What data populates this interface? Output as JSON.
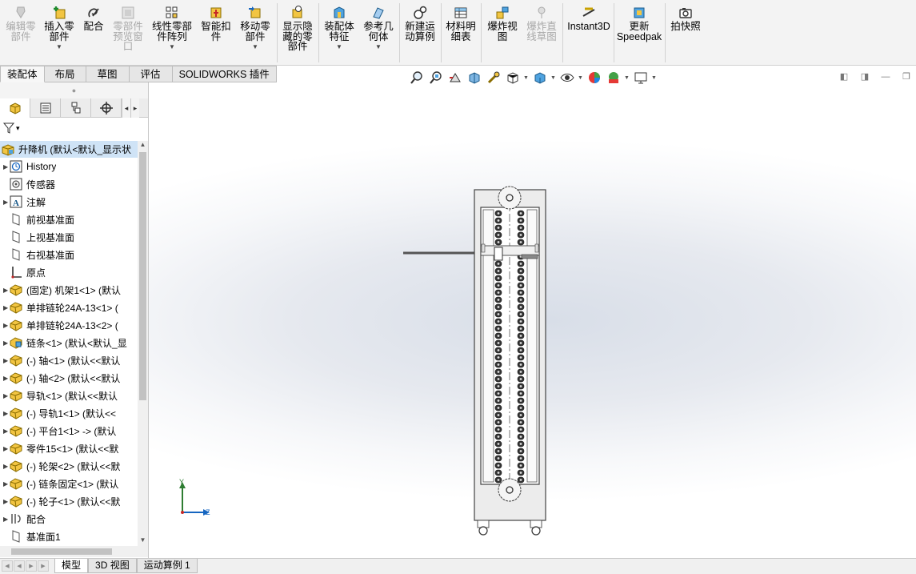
{
  "ribbon": {
    "buttons": [
      {
        "label": "编辑零\n部件",
        "icon": "edit-component-icon",
        "disabled": true
      },
      {
        "label": "插入零\n部件",
        "icon": "insert-component-icon",
        "disabled": false
      },
      {
        "label": "配合",
        "icon": "mate-icon",
        "disabled": false
      },
      {
        "label": "零部件\n预览窗\n口",
        "icon": "preview-window-icon",
        "disabled": true
      },
      {
        "label": "线性零部\n件阵列",
        "icon": "linear-pattern-icon",
        "disabled": false
      },
      {
        "label": "智能扣\n件",
        "icon": "smart-fastener-icon",
        "disabled": false
      },
      {
        "label": "移动零\n部件",
        "icon": "move-component-icon",
        "disabled": false
      },
      {
        "label": "显示隐\n藏的零\n部件",
        "icon": "show-hidden-icon",
        "disabled": false
      },
      {
        "label": "装配体\n特征",
        "icon": "assembly-feature-icon",
        "disabled": false
      },
      {
        "label": "参考几\n何体",
        "icon": "reference-geometry-icon",
        "disabled": false
      },
      {
        "label": "新建运\n动算例",
        "icon": "motion-study-icon",
        "disabled": false
      },
      {
        "label": "材料明\n细表",
        "icon": "bill-of-materials-icon",
        "disabled": false
      },
      {
        "label": "爆炸视\n图",
        "icon": "exploded-view-icon",
        "disabled": false
      },
      {
        "label": "爆炸直\n线草图",
        "icon": "explode-line-sketch-icon",
        "disabled": true
      },
      {
        "label": "Instant3D",
        "icon": "instant3d-icon",
        "disabled": false
      },
      {
        "label": "更新\nSpeedpak",
        "icon": "speedpak-icon",
        "disabled": false
      },
      {
        "label": "拍快照",
        "icon": "snapshot-icon",
        "disabled": false
      }
    ]
  },
  "command_tabs": [
    "装配体",
    "布局",
    "草图",
    "评估",
    "SOLIDWORKS 插件"
  ],
  "feature_tree": {
    "root": "升降机 (默认<默认_显示状",
    "items": [
      {
        "label": "History",
        "icon": "history-icon",
        "expand": true
      },
      {
        "label": "传感器",
        "icon": "sensor-icon",
        "expand": false
      },
      {
        "label": "注解",
        "icon": "annotation-icon",
        "expand": true
      },
      {
        "label": "前视基准面",
        "icon": "plane-icon",
        "expand": false
      },
      {
        "label": "上视基准面",
        "icon": "plane-icon",
        "expand": false
      },
      {
        "label": "右视基准面",
        "icon": "plane-icon",
        "expand": false
      },
      {
        "label": "原点",
        "icon": "origin-icon",
        "expand": false
      },
      {
        "label": "(固定) 机架1<1> (默认",
        "icon": "part-icon",
        "expand": true
      },
      {
        "label": "单排链轮24A-13<1> (",
        "icon": "part-icon",
        "expand": true
      },
      {
        "label": "单排链轮24A-13<2> (",
        "icon": "part-icon",
        "expand": true
      },
      {
        "label": "链条<1> (默认<默认_显",
        "icon": "subassembly-icon",
        "expand": true
      },
      {
        "label": "(-) 轴<1> (默认<<默认",
        "icon": "part-icon",
        "expand": true
      },
      {
        "label": "(-) 轴<2> (默认<<默认",
        "icon": "part-icon",
        "expand": true
      },
      {
        "label": "导轨<1> (默认<<默认",
        "icon": "part-icon",
        "expand": true
      },
      {
        "label": "(-) 导轨1<1> (默认<<",
        "icon": "part-icon",
        "expand": true
      },
      {
        "label": "(-) 平台1<1> -> (默认",
        "icon": "part-icon",
        "expand": true
      },
      {
        "label": "零件15<1> (默认<<默",
        "icon": "part-icon",
        "expand": true
      },
      {
        "label": "(-) 轮架<2> (默认<<默",
        "icon": "part-icon",
        "expand": true
      },
      {
        "label": "(-) 链条固定<1> (默认",
        "icon": "part-icon",
        "expand": true
      },
      {
        "label": "(-) 轮子<1> (默认<<默",
        "icon": "part-icon",
        "expand": true
      },
      {
        "label": "配合",
        "icon": "mates-icon",
        "expand": true
      },
      {
        "label": "基准面1",
        "icon": "plane-icon",
        "expand": false
      }
    ]
  },
  "triad": {
    "y": "Y",
    "z": "Z"
  },
  "bottom_tabs": [
    "模型",
    "3D 视图",
    "运动算例 1"
  ]
}
